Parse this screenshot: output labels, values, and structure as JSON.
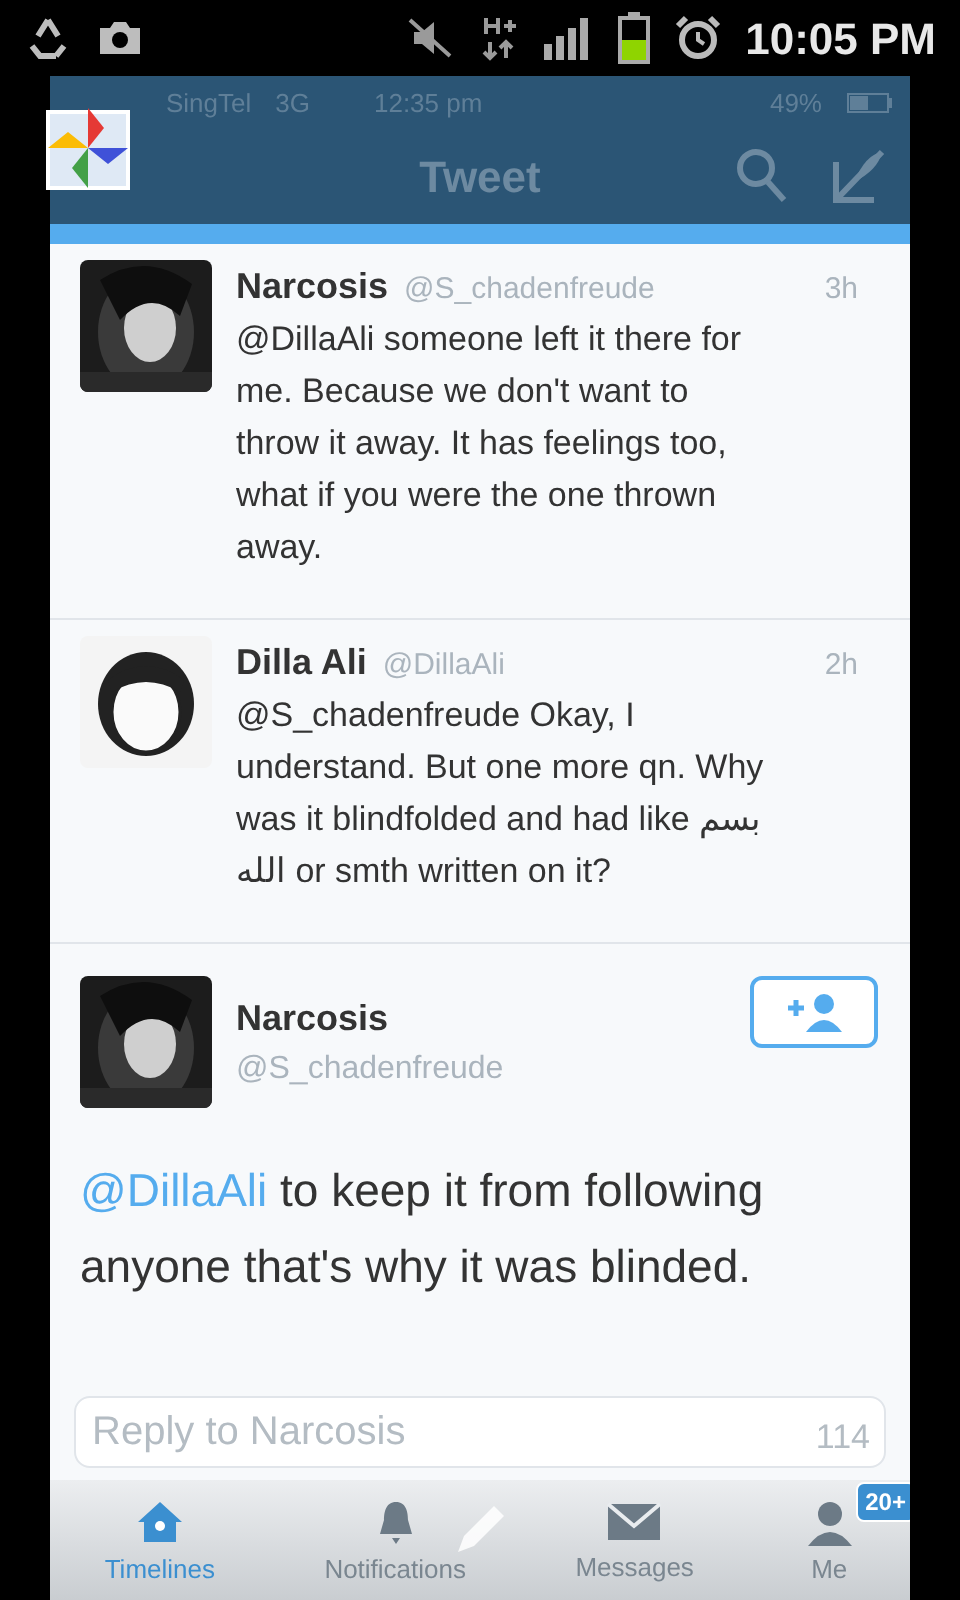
{
  "android_status": {
    "time": "10:05 PM"
  },
  "ios_status": {
    "carrier": "SingTel",
    "network": "3G",
    "time": "12:35 pm",
    "battery": "49%"
  },
  "nav": {
    "title": "Tweet"
  },
  "replies": [
    {
      "name": "Narcosis",
      "handle": "@S_chadenfreude",
      "time": "3h",
      "text": "@DillaAli someone left it there for me. Because we don't want to throw it away. It has feelings too, what if you were the one thrown away."
    },
    {
      "name": "Dilla Ali",
      "handle": "@DillaAli",
      "time": "2h",
      "text": "@S_chadenfreude Okay, I understand. But one more qn. Why was it blindfolded and had like بسم الله or smth written on it?"
    }
  ],
  "main_tweet": {
    "name": "Narcosis",
    "handle": "@S_chadenfreude",
    "mention": "@DillaAli",
    "text": "to keep it from following anyone that's why it was blinded."
  },
  "reply_field": {
    "placeholder": "Reply to Narcosis",
    "count": "114"
  },
  "tabs": [
    {
      "label": "Timelines",
      "selected": true,
      "kind": "home"
    },
    {
      "label": "Notifications",
      "selected": false,
      "kind": "bell"
    },
    {
      "label": "Messages",
      "selected": false,
      "kind": "mail"
    },
    {
      "label": "Me",
      "selected": false,
      "kind": "me",
      "badge": "20+"
    }
  ]
}
